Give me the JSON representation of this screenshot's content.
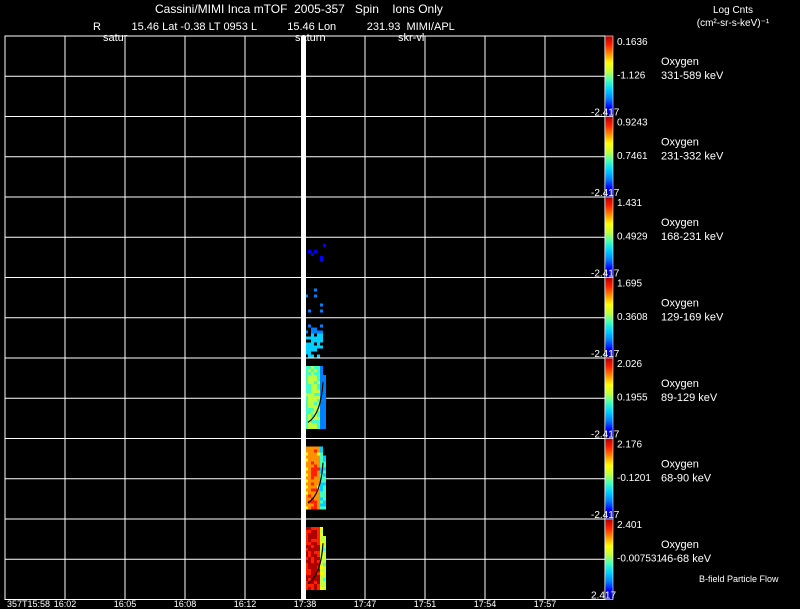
{
  "header": {
    "title": "Cassini/MIMI Inca mTOF  2005-357   Spin    Ions Only",
    "position": "R          15.46 Lat -0.38 LT 0953 L          15.46 Lon          231.93  MIMI/APL",
    "marker_left": "satur",
    "marker_center": "saturn",
    "marker_right": "skr-vl"
  },
  "colorbar_units": {
    "line1": "Log Cnts",
    "line2": "(cm²-sr-s-keV)⁻¹"
  },
  "footer_note": "B-field Particle Flow",
  "chart_data": {
    "type": "heatmap",
    "title": "Cassini/MIMI Inca mTOF  2005-357   Spin    Ions Only",
    "x_tick_labels": [
      "357T15:58",
      "16:02",
      "16:05",
      "16:08",
      "16:12",
      "17:38",
      "17:47",
      "17:51",
      "17:54",
      "17:57"
    ],
    "grid": true,
    "colormap": [
      "#00008b",
      "#0000ff",
      "#0080ff",
      "#00d0ff",
      "#40ffc0",
      "#c0ff40",
      "#ffff00",
      "#ff9000",
      "#ff2000",
      "#b00000"
    ],
    "panels": [
      {
        "species": "Oxygen",
        "energy": "331-589 keV",
        "cmax": "0.1636",
        "cmid": "-1.126",
        "cmin": "-2.417",
        "activity": 0
      },
      {
        "species": "Oxygen",
        "energy": "231-332 keV",
        "cmax": "0.9243",
        "cmid": "0.7461",
        "cmin": "-2.417",
        "activity": 0
      },
      {
        "species": "Oxygen",
        "energy": "168-231 keV",
        "cmax": "1.431",
        "cmid": "0.4929",
        "cmin": "-2.417",
        "activity": 1
      },
      {
        "species": "Oxygen",
        "energy": "129-169 keV",
        "cmax": "1.695",
        "cmid": "0.3608",
        "cmin": "-2.417",
        "activity": 2
      },
      {
        "species": "Oxygen",
        "energy": "89-129 keV",
        "cmax": "2.026",
        "cmid": "0.1955",
        "cmin": "-2.417",
        "activity": 3
      },
      {
        "species": "Oxygen",
        "energy": "68-90 keV",
        "cmax": "2.176",
        "cmid": "-0.1201",
        "cmin": "-2.417",
        "activity": 4
      },
      {
        "species": "Oxygen",
        "energy": "46-68 keV",
        "cmax": "2.401",
        "cmid": "-0.007531",
        "cmin": "2.417",
        "activity": 5
      }
    ]
  }
}
